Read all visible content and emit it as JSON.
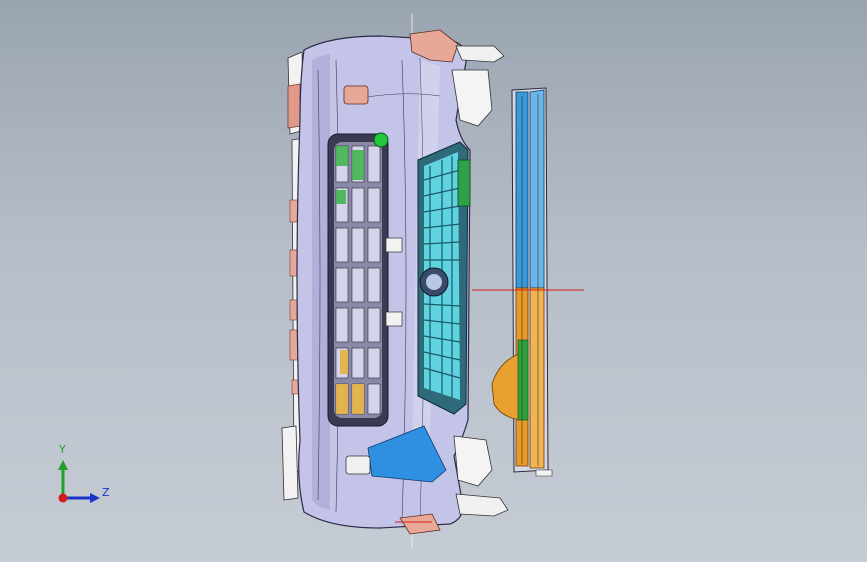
{
  "view": {
    "background_top": "#9aa4b1",
    "background_bottom": "#c6ccd4"
  },
  "triad": {
    "y_label": "Y",
    "z_label": "Z",
    "y_color": "#1fa02a",
    "z_color": "#1a33c8",
    "x_color": "#d21c1c"
  },
  "model": {
    "bumper_color": "#c4c3e8",
    "accent_blue": "#2f8fe0",
    "accent_orange": "#f0a030",
    "accent_green": "#2fc03a",
    "accent_cyan": "#5fd4e0",
    "accent_pink": "#e09a8a"
  }
}
